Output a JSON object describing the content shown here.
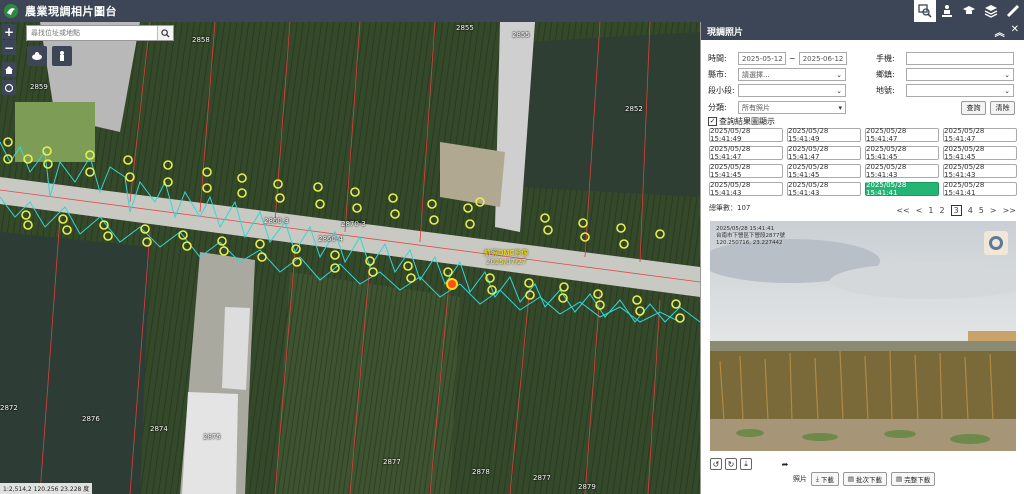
{
  "app": {
    "title": "農業現調相片圖台"
  },
  "top_tools": [
    "search-photo-icon",
    "person-tree-icon",
    "graduation-cap-icon",
    "layers-icon",
    "ruler-pencil-icon"
  ],
  "map": {
    "search": {
      "placeholder": "尋找位址或地點"
    },
    "controls": {
      "zoom_in": "+",
      "zoom_out": "−"
    },
    "parcels": [
      "2858",
      "2855",
      "2855",
      "2859",
      "2852",
      "2860-3",
      "2870-3",
      "2860-4",
      "2872",
      "2874",
      "2875",
      "2876",
      "2877",
      "2878",
      "2877",
      "2879"
    ],
    "photo_label": {
      "line1": "航照DMC影像",
      "line2": "2025/07/27"
    },
    "coord_readout": "1:2,514,2   120.256 23.228 度"
  },
  "panel": {
    "title": "現調照片",
    "header_icons": [
      "chevron-up-icon",
      "close-icon"
    ],
    "filters": {
      "time_label": "時間:",
      "date_from": "2025-05-12",
      "date_sep": "~",
      "date_to": "2025-06-12",
      "phone_label": "手機:",
      "county_label": "縣市:",
      "county_value": "請選擇...",
      "township_label": "鄉鎮:",
      "section_label": "段小段:",
      "landno_label": "地號:",
      "category_label": "分類:",
      "category_value": "所有照片",
      "query_button": "查詢",
      "clear_button": "清除",
      "checkbox_label": "查詢結果圖顯示"
    },
    "timestamps": [
      "2025/05/28 15:41:49",
      "2025/05/28 15:41:49",
      "2025/05/28 15:41:47",
      "2025/05/28 15:41:47",
      "2025/05/28 15:41:47",
      "2025/05/28 15:41:47",
      "2025/05/28 15:41:45",
      "2025/05/28 15:41:45",
      "2025/05/28 15:41:45",
      "2025/05/28 15:41:45",
      "2025/05/28 15:41:43",
      "2025/05/28 15:41:43",
      "2025/05/28 15:41:43",
      "2025/05/28 15:41:43",
      "2025/05/28 15:41:41",
      "2025/05/28 15:41:41"
    ],
    "selected_index": 14,
    "total": "總筆數：107",
    "pager": {
      "first": "<<",
      "prev": "<",
      "p1": "1",
      "p2": "2",
      "p3": "3",
      "p4": "4",
      "p5": "5",
      "next": ">",
      "last": ">>"
    },
    "photo_stamp": {
      "line1": "2025/05/28 15:41:41",
      "line2": "台南市下營區下營段2877號",
      "line3": "120.250716, 23.227442"
    },
    "photo_tools": [
      "rotate-left-icon",
      "rotate-right-icon",
      "download-icon",
      "share-icon"
    ],
    "download": {
      "label": "照片",
      "download": "下載",
      "batch": "批次下載",
      "full": "完整下載"
    }
  }
}
